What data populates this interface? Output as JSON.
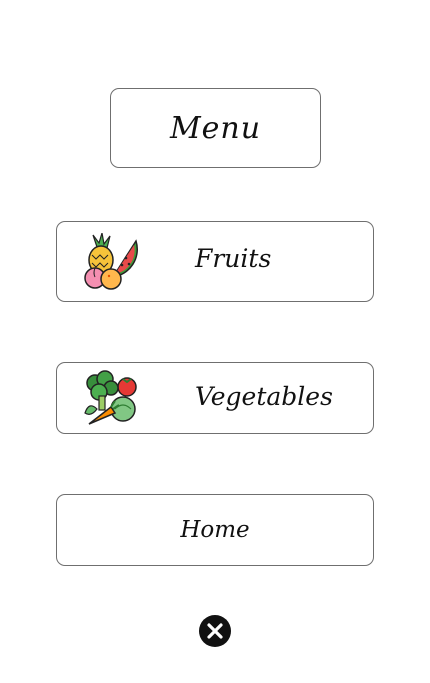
{
  "header": {
    "title": "Menu"
  },
  "buttons": {
    "fruits": {
      "label": "Fruits",
      "icon": "fruits-icon"
    },
    "vegetables": {
      "label": "Vegetables",
      "icon": "vegetables-icon"
    },
    "home": {
      "label": "Home"
    }
  },
  "close": {
    "icon": "close-icon"
  }
}
